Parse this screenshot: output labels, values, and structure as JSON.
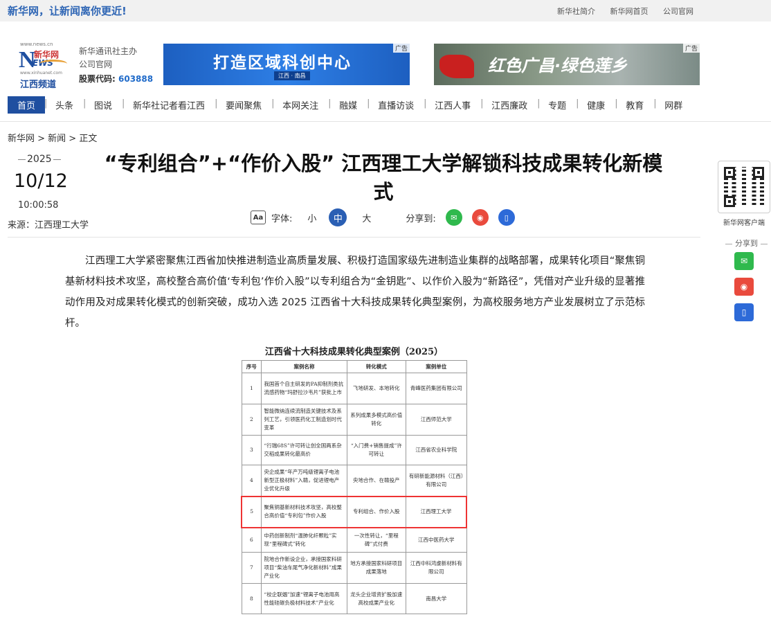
{
  "topbar": {
    "slogan": "新华网，让新闻离你更近!",
    "links": [
      "新华社简介",
      "新华网首页",
      "公司官网"
    ]
  },
  "logo": {
    "url": "www.news.cn",
    "mark": "N",
    "xinhua": "新华网",
    "ews": "EWS",
    "url2": "www.xinhuanet.com",
    "channel": "江西频道"
  },
  "sponsor": {
    "line1": "新华通讯社主办",
    "line2": "公司官网",
    "stock_label": "股票代码:",
    "stock_code": "603888"
  },
  "ads": [
    {
      "text": "打造区域科创中心",
      "sub": "江西 · 南昌",
      "tag": "广告"
    },
    {
      "text": "红色广昌·绿色莲乡",
      "tag": "广告"
    }
  ],
  "nav": [
    "首页",
    "头条",
    "图说",
    "新华社记者看江西",
    "要闻聚焦",
    "本网关注",
    "融媒",
    "直播访谈",
    "江西人事",
    "江西廉政",
    "专题",
    "健康",
    "教育",
    "网群"
  ],
  "breadcrumb": "新华网 > 新闻 > 正文",
  "date": {
    "year": "2025",
    "md": "10/12",
    "time": "10:00:58"
  },
  "source": "来源：江西理工大学",
  "title": "“专利组合”+“作价入股” 江西理工大学解锁科技成果转化新模式",
  "tools": {
    "font_label": "字体:",
    "small": "小",
    "medium": "中",
    "large": "大",
    "share_label": "分享到:"
  },
  "body": "江西理工大学紧密聚焦江西省加快推进制造业高质量发展、积极打造国家级先进制造业集群的战略部署，成果转化项目“聚焦铜基新材料技术攻坚，高校整合高价值‘专利包’作价入股”以专利组合为“金钥匙”、以作价入股为“新路径”，凭借对产业升级的显著推动作用及对成果转化模式的创新突破，成功入选 2025 江西省十大科技成果转化典型案例，为高校服务地方产业发展树立了示范标杆。",
  "figure": {
    "caption": "江西省十大科技成果转化典型案例（2025）",
    "headers": [
      "序号",
      "案例名称",
      "转化模式",
      "案例单位"
    ],
    "rows": [
      [
        "1",
        "我国首个自主研发的PA抑制剂类抗流感药物“玛舒拉沙韦片”获批上市",
        "飞地研发、本地转化",
        "青峰医药集团有限公司"
      ],
      [
        "2",
        "智能微纳连续流制造关键技术及系列工艺，引领医药化工制造划时代变革",
        "系列成果多模式高价值转化",
        "江西师范大学"
      ],
      [
        "3",
        "“行瑞68S”许可转让创全国两系杂交稻成果转化最高价",
        "“入门费+销售提成”许可转让",
        "江西省农业科学院"
      ],
      [
        "4",
        "央企成果“年产万吨级锂离子电池新型正极材料”入赣，促进锂电产业优化升级",
        "央地合作、在赣投产",
        "有研新能源材料（江西）有限公司"
      ],
      [
        "5",
        "聚焦铜基新材料技术攻坚，高校整合高价值“专利包”作价入股",
        "专利组合、作价入股",
        "江西理工大学"
      ],
      [
        "6",
        "中药创新制剂“温肺化纤颗粒”实现“里程碑式”转化",
        "一次性转让，“里程碑”式付费",
        "江西中医药大学"
      ],
      [
        "7",
        "院地合作新设企业，承接国家科研项目“柴油车尾气净化新材料”成果产业化",
        "地方承接国家科研项目成果落地",
        "江西中科鸿虔新材料有限公司"
      ],
      [
        "8",
        "“校企联姻”加速“锂离子电池用高性能硅碳负极材料技术”产业化",
        "龙头企业增资扩股加速高校成果产业化",
        "南昌大学"
      ]
    ]
  },
  "side": {
    "qr_label": "新华网客户端",
    "share_label": "分享到"
  },
  "icons": {
    "wechat": "wechat-icon",
    "weibo": "weibo-icon",
    "mobile": "mobile-icon"
  },
  "colors": {
    "brand": "#1f4fa0",
    "wechat": "#2fb94d",
    "weibo": "#e94a3d",
    "mobile": "#2d6ad8",
    "highlight": "#e33333"
  }
}
